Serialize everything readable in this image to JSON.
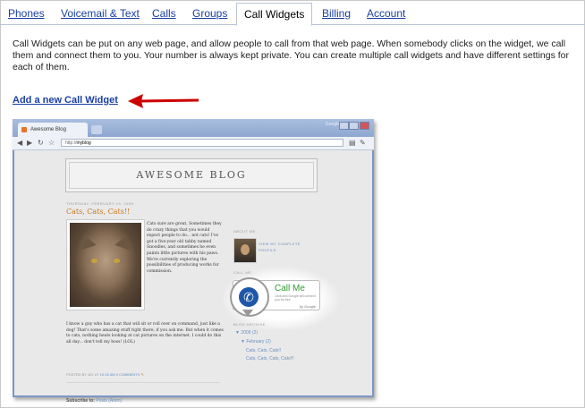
{
  "tabs": [
    {
      "label": "Phones"
    },
    {
      "label": "Voicemail & Text"
    },
    {
      "label": "Calls"
    },
    {
      "label": "Groups"
    },
    {
      "label": "Call Widgets",
      "active": true
    },
    {
      "label": "Billing"
    },
    {
      "label": "Account"
    }
  ],
  "description": "Call Widgets can be put on any web page, and allow people to call from that web page. When somebody clicks on the widget, we call them and connect them to you. Your number is always kept private. You can create multiple call widgets and have different settings for each of them.",
  "add_link": "Add a new Call Widget",
  "colors": {
    "link": "#1a3fa0",
    "arrow": "#cc0000",
    "call_me_green": "#2b9b2b",
    "phone_blue": "#1e56a8"
  },
  "screenshot": {
    "browser": {
      "tab_title": "Awesome Blog",
      "google_label": "Google",
      "url_prefix": "http://",
      "url_host": "myblog"
    },
    "blog": {
      "title": "AWESOME BLOG",
      "post_date": "THURSDAY, FEBRUARY 19, 2009",
      "post_title": "Cats, Cats, Cats!!",
      "post_body": "Cats sure are great. Sometimes they do crazy things that you would expect people to do... not cats! I've got a five-year old tabby named Snoodles, and sometimes he even paints little pictures with his paws. We're currently exploring the possibilities of producing works for commission.",
      "post_body2": "I know a guy who has a cat that will sit or roll over on command, just like a dog! That's some amazing stuff right there, if you ask me. But when it comes to cats, nothing beats looking at cat pictures on the internet. I could do this all day... don't tell my boss! (LOL)",
      "posted_by": "POSTED BY JAY AT",
      "posted_time": "10:28 AM",
      "comments": "0 COMMENTS",
      "subscribe_label": "Subscribe to:",
      "subscribe_link": "Posts (Atom)",
      "about_me": "ABOUT ME",
      "profile_link_1": "VIEW MY COMPLETE",
      "profile_link_2": "PROFILE",
      "call_me_heading": "CALL ME",
      "widget_call_me": "Call Me",
      "widget_small": "Click and Google will connect you for free",
      "widget_powered": "by Google",
      "archive_heading": "BLOG ARCHIVE",
      "archive_year": "▼ 2009 (2)",
      "archive_month": "▼ February (2)",
      "archive_posts": [
        "Cats, Cats, Cats!!",
        "Cats, Cats, Cats, Cats!!!"
      ]
    }
  }
}
